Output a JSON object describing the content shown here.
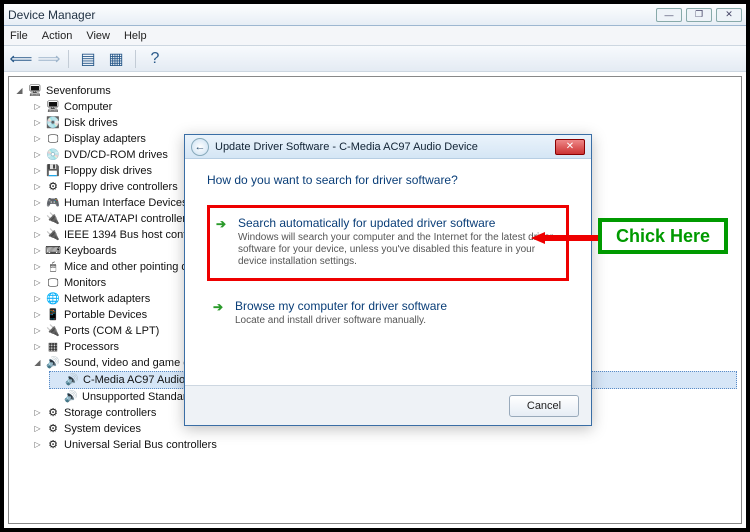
{
  "window": {
    "title": "Device Manager"
  },
  "window_controls": {
    "min": "—",
    "max": "❐",
    "close": "✕"
  },
  "menu": {
    "file": "File",
    "action": "Action",
    "view": "View",
    "help": "Help"
  },
  "tree": {
    "root": "Sevenforums",
    "items": [
      "Computer",
      "Disk drives",
      "Display adapters",
      "DVD/CD-ROM drives",
      "Floppy disk drives",
      "Floppy drive controllers",
      "Human Interface Devices",
      "IDE ATA/ATAPI controllers",
      "IEEE 1394 Bus host controllers",
      "Keyboards",
      "Mice and other pointing devices",
      "Monitors",
      "Network adapters",
      "Portable Devices",
      "Ports (COM & LPT)",
      "Processors"
    ],
    "sound_label": "Sound, video and game controllers",
    "sound_children": [
      "C-Media AC97 Audio Device",
      "Unsupported Standard Game"
    ],
    "tail": [
      "Storage controllers",
      "System devices",
      "Universal Serial Bus controllers"
    ]
  },
  "dialog": {
    "title": "Update Driver Software - C-Media AC97 Audio Device",
    "heading": "How do you want to search for driver software?",
    "opt1_title": "Search automatically for updated driver software",
    "opt1_desc": "Windows will search your computer and the Internet for the latest driver software for your device, unless you've disabled this feature in your device installation settings.",
    "opt2_title": "Browse my computer for driver software",
    "opt2_desc": "Locate and install driver software manually.",
    "cancel": "Cancel"
  },
  "annotation": {
    "label": "Chick Here"
  }
}
